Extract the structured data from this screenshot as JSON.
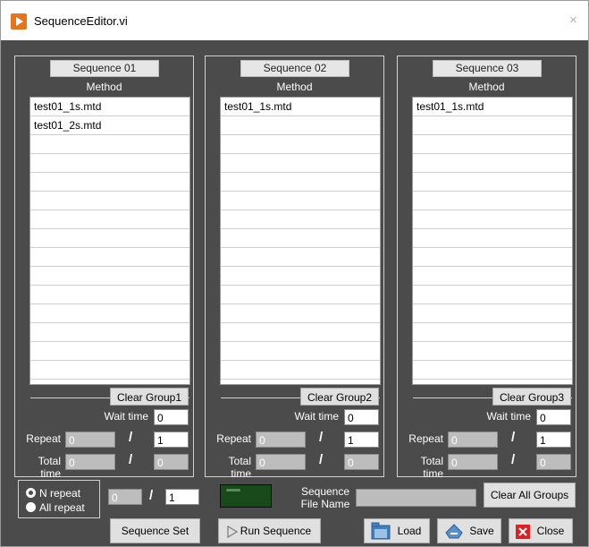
{
  "window": {
    "title": "SequenceEditor.vi",
    "close_glyph": "×"
  },
  "sequences": [
    {
      "label": "Sequence 01",
      "method_header": "Method",
      "methods": [
        "test01_1s.mtd",
        "test01_2s.mtd",
        "",
        "",
        "",
        "",
        "",
        "",
        "",
        "",
        "",
        "",
        "",
        "",
        "",
        ""
      ],
      "clear_label": "Clear Group1",
      "wait_label": "Wait time",
      "wait_value": "0",
      "repeat_label": "Repeat",
      "repeat_current": "0",
      "repeat_total": "1",
      "total_label": "Total time",
      "total_current": "0",
      "total_total": "0",
      "slash": "/"
    },
    {
      "label": "Sequence 02",
      "method_header": "Method",
      "methods": [
        "test01_1s.mtd",
        "",
        "",
        "",
        "",
        "",
        "",
        "",
        "",
        "",
        "",
        "",
        "",
        "",
        "",
        ""
      ],
      "clear_label": "Clear Group2",
      "wait_label": "Wait time",
      "wait_value": "0",
      "repeat_label": "Repeat",
      "repeat_current": "0",
      "repeat_total": "1",
      "total_label": "Total time",
      "total_current": "0",
      "total_total": "0",
      "slash": "/"
    },
    {
      "label": "Sequence 03",
      "method_header": "Method",
      "methods": [
        "test01_1s.mtd",
        "",
        "",
        "",
        "",
        "",
        "",
        "",
        "",
        "",
        "",
        "",
        "",
        "",
        "",
        ""
      ],
      "clear_label": "Clear Group3",
      "wait_label": "Wait time",
      "wait_value": "0",
      "repeat_label": "Repeat",
      "repeat_current": "0",
      "repeat_total": "1",
      "total_label": "Total time",
      "total_current": "0",
      "total_total": "0",
      "slash": "/"
    }
  ],
  "bottom": {
    "repeat_mode": {
      "options": [
        "N repeat",
        "All repeat"
      ],
      "selected": "N repeat"
    },
    "n_current": "0",
    "n_total": "1",
    "slash": "/",
    "sequence_set_label": "Sequence Set",
    "run_sequence_label": "Run Sequence",
    "seq_file_label_line1": "Sequence",
    "seq_file_label_line2": "File Name",
    "seq_file_value": "",
    "clear_all_label": "Clear All Groups",
    "load_label": "Load",
    "save_label": "Save",
    "close_label": "Close"
  },
  "icons": {
    "app": "app-run-icon",
    "run": "play-icon",
    "load": "folder-icon",
    "save": "save-icon",
    "close": "close-icon"
  },
  "colors": {
    "background": "#4b4b4b",
    "button": "#e0e0e0",
    "led_off": "#184a1c",
    "close_red": "#e02020"
  }
}
